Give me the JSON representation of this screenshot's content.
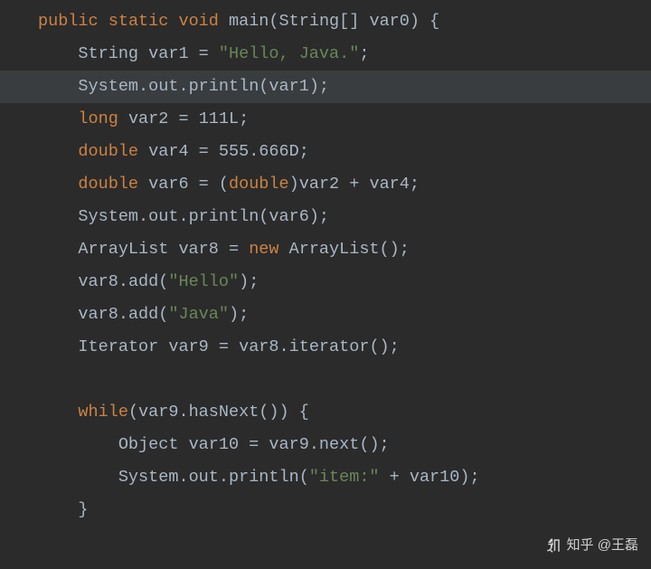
{
  "code": {
    "lines": [
      {
        "hl": false,
        "indent": 0,
        "tokens": [
          {
            "c": "kw",
            "t": "public"
          },
          {
            "c": "pun",
            "t": " "
          },
          {
            "c": "kw",
            "t": "static"
          },
          {
            "c": "pun",
            "t": " "
          },
          {
            "c": "kw",
            "t": "void"
          },
          {
            "c": "pun",
            "t": " "
          },
          {
            "c": "mth",
            "t": "main"
          },
          {
            "c": "pun",
            "t": "("
          },
          {
            "c": "typ",
            "t": "String"
          },
          {
            "c": "pun",
            "t": "[] "
          },
          {
            "c": "var",
            "t": "var0"
          },
          {
            "c": "pun",
            "t": ") {"
          }
        ]
      },
      {
        "hl": false,
        "indent": 1,
        "tokens": [
          {
            "c": "typ",
            "t": "String"
          },
          {
            "c": "pun",
            "t": " "
          },
          {
            "c": "var",
            "t": "var1"
          },
          {
            "c": "pun",
            "t": " = "
          },
          {
            "c": "str",
            "t": "\"Hello, Java.\""
          },
          {
            "c": "pun",
            "t": ";"
          }
        ]
      },
      {
        "hl": true,
        "indent": 1,
        "tokens": [
          {
            "c": "typ",
            "t": "System"
          },
          {
            "c": "pun",
            "t": "."
          },
          {
            "c": "var",
            "t": "out"
          },
          {
            "c": "pun",
            "t": "."
          },
          {
            "c": "mth",
            "t": "println"
          },
          {
            "c": "pun",
            "t": "("
          },
          {
            "c": "var",
            "t": "var1"
          },
          {
            "c": "pun",
            "t": ");"
          }
        ]
      },
      {
        "hl": false,
        "indent": 1,
        "tokens": [
          {
            "c": "kw",
            "t": "long"
          },
          {
            "c": "pun",
            "t": " "
          },
          {
            "c": "var",
            "t": "var2"
          },
          {
            "c": "pun",
            "t": " = "
          },
          {
            "c": "num",
            "t": "111L"
          },
          {
            "c": "pun",
            "t": ";"
          }
        ]
      },
      {
        "hl": false,
        "indent": 1,
        "tokens": [
          {
            "c": "kw",
            "t": "double"
          },
          {
            "c": "pun",
            "t": " "
          },
          {
            "c": "var",
            "t": "var4"
          },
          {
            "c": "pun",
            "t": " = "
          },
          {
            "c": "num",
            "t": "555.666D"
          },
          {
            "c": "pun",
            "t": ";"
          }
        ]
      },
      {
        "hl": false,
        "indent": 1,
        "tokens": [
          {
            "c": "kw",
            "t": "double"
          },
          {
            "c": "pun",
            "t": " "
          },
          {
            "c": "var",
            "t": "var6"
          },
          {
            "c": "pun",
            "t": " = ("
          },
          {
            "c": "kw",
            "t": "double"
          },
          {
            "c": "pun",
            "t": ")"
          },
          {
            "c": "var",
            "t": "var2"
          },
          {
            "c": "pun",
            "t": " + "
          },
          {
            "c": "var",
            "t": "var4"
          },
          {
            "c": "pun",
            "t": ";"
          }
        ]
      },
      {
        "hl": false,
        "indent": 1,
        "tokens": [
          {
            "c": "typ",
            "t": "System"
          },
          {
            "c": "pun",
            "t": "."
          },
          {
            "c": "var",
            "t": "out"
          },
          {
            "c": "pun",
            "t": "."
          },
          {
            "c": "mth",
            "t": "println"
          },
          {
            "c": "pun",
            "t": "("
          },
          {
            "c": "var",
            "t": "var6"
          },
          {
            "c": "pun",
            "t": ");"
          }
        ]
      },
      {
        "hl": false,
        "indent": 1,
        "tokens": [
          {
            "c": "typ",
            "t": "ArrayList"
          },
          {
            "c": "pun",
            "t": " "
          },
          {
            "c": "var",
            "t": "var8"
          },
          {
            "c": "pun",
            "t": " = "
          },
          {
            "c": "kw",
            "t": "new"
          },
          {
            "c": "pun",
            "t": " "
          },
          {
            "c": "typ",
            "t": "ArrayList"
          },
          {
            "c": "pun",
            "t": "();"
          }
        ]
      },
      {
        "hl": false,
        "indent": 1,
        "tokens": [
          {
            "c": "var",
            "t": "var8"
          },
          {
            "c": "pun",
            "t": "."
          },
          {
            "c": "mth",
            "t": "add"
          },
          {
            "c": "pun",
            "t": "("
          },
          {
            "c": "str",
            "t": "\"Hello\""
          },
          {
            "c": "pun",
            "t": ");"
          }
        ]
      },
      {
        "hl": false,
        "indent": 1,
        "tokens": [
          {
            "c": "var",
            "t": "var8"
          },
          {
            "c": "pun",
            "t": "."
          },
          {
            "c": "mth",
            "t": "add"
          },
          {
            "c": "pun",
            "t": "("
          },
          {
            "c": "str",
            "t": "\"Java\""
          },
          {
            "c": "pun",
            "t": ");"
          }
        ]
      },
      {
        "hl": false,
        "indent": 1,
        "tokens": [
          {
            "c": "typ",
            "t": "Iterator"
          },
          {
            "c": "pun",
            "t": " "
          },
          {
            "c": "var",
            "t": "var9"
          },
          {
            "c": "pun",
            "t": " = "
          },
          {
            "c": "var",
            "t": "var8"
          },
          {
            "c": "pun",
            "t": "."
          },
          {
            "c": "mth",
            "t": "iterator"
          },
          {
            "c": "pun",
            "t": "();"
          }
        ]
      },
      {
        "hl": false,
        "indent": 0,
        "blank": true,
        "tokens": []
      },
      {
        "hl": false,
        "indent": 1,
        "tokens": [
          {
            "c": "kw",
            "t": "while"
          },
          {
            "c": "pun",
            "t": "("
          },
          {
            "c": "var",
            "t": "var9"
          },
          {
            "c": "pun",
            "t": "."
          },
          {
            "c": "mth",
            "t": "hasNext"
          },
          {
            "c": "pun",
            "t": "()) {"
          }
        ]
      },
      {
        "hl": false,
        "indent": 2,
        "tokens": [
          {
            "c": "typ",
            "t": "Object"
          },
          {
            "c": "pun",
            "t": " "
          },
          {
            "c": "var",
            "t": "var10"
          },
          {
            "c": "pun",
            "t": " = "
          },
          {
            "c": "var",
            "t": "var9"
          },
          {
            "c": "pun",
            "t": "."
          },
          {
            "c": "mth",
            "t": "next"
          },
          {
            "c": "pun",
            "t": "();"
          }
        ]
      },
      {
        "hl": false,
        "indent": 2,
        "tokens": [
          {
            "c": "typ",
            "t": "System"
          },
          {
            "c": "pun",
            "t": "."
          },
          {
            "c": "var",
            "t": "out"
          },
          {
            "c": "pun",
            "t": "."
          },
          {
            "c": "mth",
            "t": "println"
          },
          {
            "c": "pun",
            "t": "("
          },
          {
            "c": "str",
            "t": "\"item:\""
          },
          {
            "c": "pun",
            "t": " + "
          },
          {
            "c": "var",
            "t": "var10"
          },
          {
            "c": "pun",
            "t": ");"
          }
        ]
      },
      {
        "hl": false,
        "indent": 1,
        "tokens": [
          {
            "c": "pun",
            "t": "}"
          }
        ]
      }
    ]
  },
  "watermark": {
    "text": "知乎 @王磊"
  }
}
